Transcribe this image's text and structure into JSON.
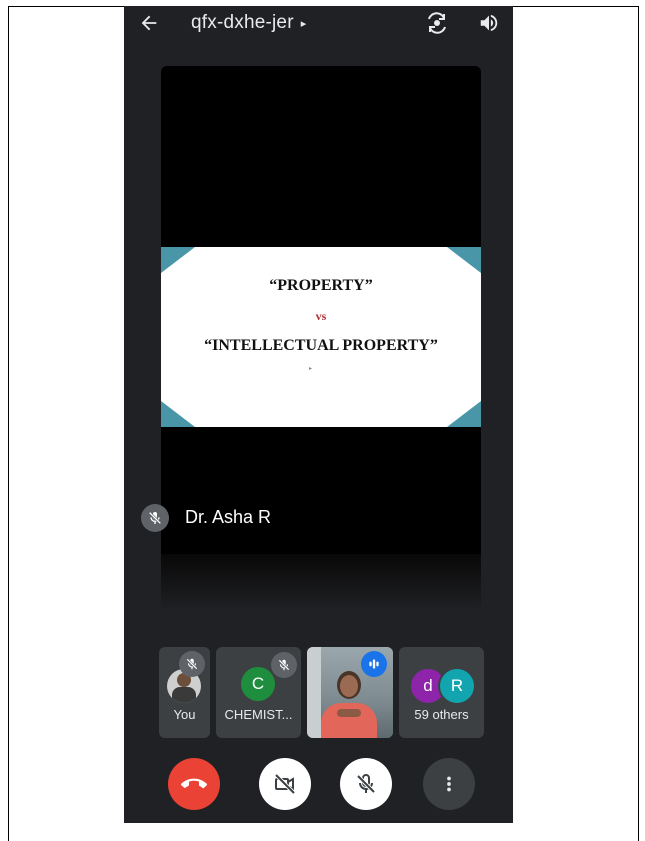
{
  "meeting": {
    "code": "qfx-dxhe-jer",
    "caret": "▸"
  },
  "slide": {
    "line1": "“PROPERTY”",
    "vs": "vs",
    "line2": "“INTELLECTUAL PROPERTY”"
  },
  "presenter": {
    "name": "Dr. Asha R",
    "muted": true
  },
  "participants": [
    {
      "label": "You",
      "muted": true
    },
    {
      "label": "CHEMIST...",
      "avatar_letter": "C",
      "avatar_color": "#1e8e3e",
      "muted": true
    },
    {
      "label": "",
      "speaking": true
    },
    {
      "label": "59 others",
      "avatar_letters": [
        "d",
        "R"
      ],
      "avatar_colors": [
        "#8e24aa",
        "#12a4af"
      ]
    }
  ],
  "controls": {
    "end_call_color": "#ea4335",
    "camera": "camera-off",
    "mic": "mic-off",
    "more": "more-vert"
  }
}
